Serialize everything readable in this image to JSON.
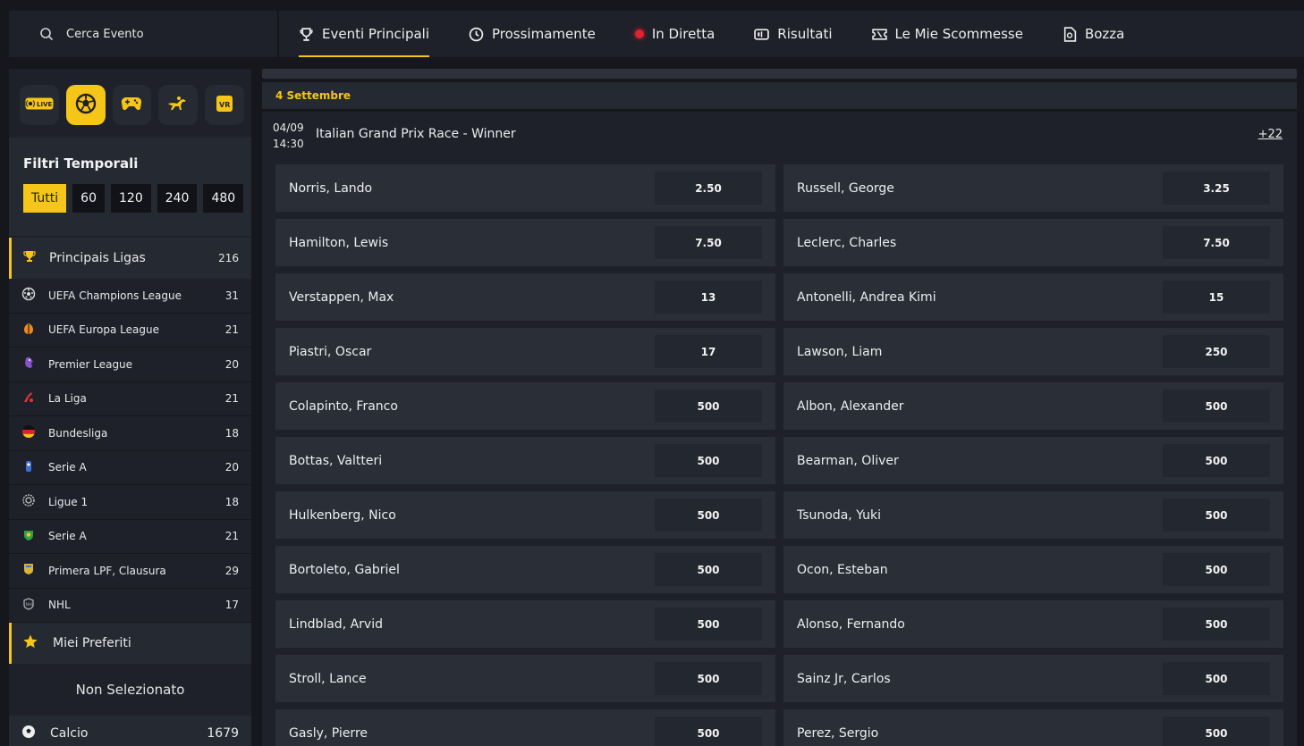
{
  "search": {
    "placeholder": "Cerca Evento",
    "icon": "search-icon"
  },
  "nav": {
    "items": [
      {
        "label": "Eventi Principali",
        "icon": "trophy-icon",
        "active": true
      },
      {
        "label": "Prossimamente",
        "icon": "clock-icon"
      },
      {
        "label": "In Diretta",
        "icon": "live-dot-icon"
      },
      {
        "label": "Risultati",
        "icon": "results-icon"
      },
      {
        "label": "Le Mie Scommesse",
        "icon": "ticket-icon"
      },
      {
        "label": "Bozza",
        "icon": "draft-icon"
      }
    ]
  },
  "colors": {
    "accent": "#f5c518",
    "background": "#15171c",
    "panel": "#1e2129",
    "cell": "#2a2e37",
    "live": "#e0232f"
  },
  "sidebar": {
    "sport_icons": [
      {
        "name": "live-icon",
        "label": "LIVE"
      },
      {
        "name": "soccer-ball-icon",
        "active": true
      },
      {
        "name": "gamepad-icon"
      },
      {
        "name": "horse-racing-icon"
      },
      {
        "name": "vr-icon",
        "label": "VR"
      }
    ],
    "filters_title": "Filtri Temporali",
    "time_filters": [
      "Tutti",
      "60",
      "120",
      "240",
      "480"
    ],
    "leagues_header": {
      "label": "Principais Ligas",
      "count": "216",
      "icon": "trophy-icon"
    },
    "leagues": [
      {
        "label": "UEFA Champions League",
        "count": "31",
        "icon": "champions-league-icon"
      },
      {
        "label": "UEFA Europa League",
        "count": "21",
        "icon": "europa-league-icon"
      },
      {
        "label": "Premier League",
        "count": "20",
        "icon": "premier-league-icon"
      },
      {
        "label": "La Liga",
        "count": "21",
        "icon": "laliga-icon"
      },
      {
        "label": "Bundesliga",
        "count": "18",
        "icon": "germany-flag-icon"
      },
      {
        "label": "Serie A",
        "count": "20",
        "icon": "serie-a-icon"
      },
      {
        "label": "Ligue 1",
        "count": "18",
        "icon": "ligue1-icon"
      },
      {
        "label": "Serie A",
        "count": "21",
        "icon": "serie-a-brazil-icon"
      },
      {
        "label": "Primera LPF, Clausura",
        "count": "29",
        "icon": "lpf-icon"
      },
      {
        "label": "NHL",
        "count": "17",
        "icon": "nhl-icon"
      }
    ],
    "favorites_label": "Miei Preferiti",
    "non_selected_label": "Non Selezionato",
    "calcio": {
      "label": "Calcio",
      "count": "1679"
    }
  },
  "main": {
    "date_label": "4 Settembre",
    "event": {
      "date": "04/09",
      "time": "14:30",
      "title": "Italian Grand Prix Race - Winner",
      "more": "+22"
    },
    "odds": [
      {
        "name": "Norris, Lando",
        "price": "2.50"
      },
      {
        "name": "Russell, George",
        "price": "3.25"
      },
      {
        "name": "Hamilton, Lewis",
        "price": "7.50"
      },
      {
        "name": "Leclerc, Charles",
        "price": "7.50"
      },
      {
        "name": "Verstappen, Max",
        "price": "13"
      },
      {
        "name": "Antonelli, Andrea Kimi",
        "price": "15"
      },
      {
        "name": "Piastri, Oscar",
        "price": "17"
      },
      {
        "name": "Lawson, Liam",
        "price": "250"
      },
      {
        "name": "Colapinto, Franco",
        "price": "500"
      },
      {
        "name": "Albon, Alexander",
        "price": "500"
      },
      {
        "name": "Bottas, Valtteri",
        "price": "500"
      },
      {
        "name": "Bearman, Oliver",
        "price": "500"
      },
      {
        "name": "Hulkenberg, Nico",
        "price": "500"
      },
      {
        "name": "Tsunoda, Yuki",
        "price": "500"
      },
      {
        "name": "Bortoleto, Gabriel",
        "price": "500"
      },
      {
        "name": "Ocon, Esteban",
        "price": "500"
      },
      {
        "name": "Lindblad, Arvid",
        "price": "500"
      },
      {
        "name": "Alonso, Fernando",
        "price": "500"
      },
      {
        "name": "Stroll, Lance",
        "price": "500"
      },
      {
        "name": "Sainz Jr, Carlos",
        "price": "500"
      },
      {
        "name": "Gasly, Pierre",
        "price": "500"
      },
      {
        "name": "Perez, Sergio",
        "price": "500"
      }
    ]
  }
}
